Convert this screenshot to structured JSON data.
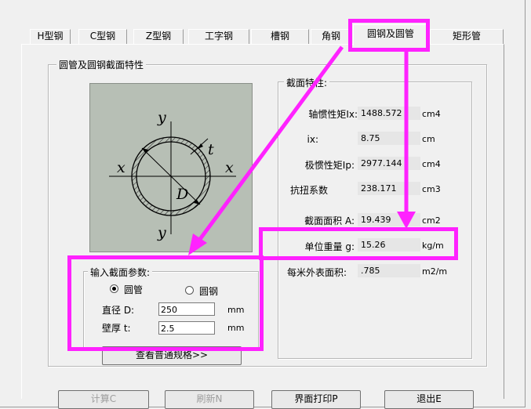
{
  "tabs": [
    "H型钢",
    "C型钢",
    "Z型钢",
    "工字钢",
    "槽钢",
    "角钢",
    "圆钢及圆管",
    "矩形管"
  ],
  "panel_title": "圆管及圆钢截面特性",
  "diagram": {
    "y_top": "y",
    "y_bottom": "y",
    "x_left": "x",
    "x_right": "x",
    "t_label": "t",
    "d_label": "D"
  },
  "props": {
    "title": "截面特性:",
    "rows": [
      {
        "label": "轴惯性矩Ix:",
        "value": "1488.572",
        "unit": "cm4"
      },
      {
        "label": "ix:",
        "value": "8.75",
        "unit": "cm"
      },
      {
        "label": "极惯性矩Ip:",
        "value": "2977.144",
        "unit": "cm4"
      },
      {
        "label": "抗扭系数",
        "value": "238.171",
        "unit": "cm3"
      },
      {
        "label": "截面面积 A:",
        "value": "19.439",
        "unit": "cm2"
      },
      {
        "label": "单位重量 g:",
        "value": "15.26",
        "unit": "kg/m"
      },
      {
        "label": "每米外表面积:",
        "value": ".785",
        "unit": "m2/m"
      }
    ]
  },
  "input_group": {
    "title": "输入截面参数:",
    "radio_pipe": "圆管",
    "radio_bar": "圆钢",
    "diameter_label": "直径 D:",
    "diameter_value": "250",
    "diameter_unit": "mm",
    "thickness_label": "壁厚 t:",
    "thickness_value": "2.5",
    "thickness_unit": "mm"
  },
  "spec_button": "查看普通规格>>",
  "bottom_buttons": [
    "计算C",
    "刷新N",
    "界面打印P",
    "退出E"
  ],
  "highlight_color": "#ff22ff"
}
